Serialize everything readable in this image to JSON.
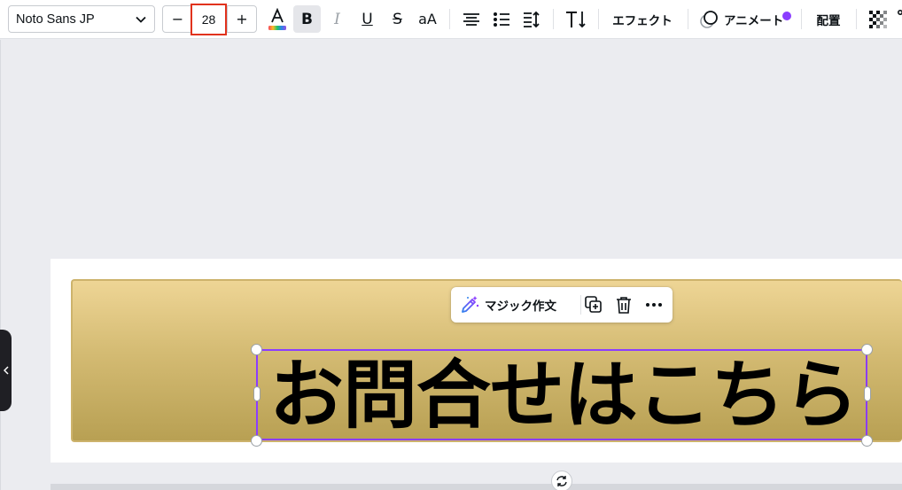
{
  "toolbar": {
    "font_name": "Noto Sans JP",
    "font_size": "28",
    "minus_label": "−",
    "plus_label": "+",
    "bold_label": "B",
    "italic_label": "I",
    "underline_label": "U",
    "strike_label": "S",
    "case_label": "aA",
    "effects_label": "エフェクト",
    "animate_label": "アニメート",
    "position_label": "配置"
  },
  "floating_toolbar": {
    "magic_write_label": "マジック作文"
  },
  "canvas": {
    "headline_text": "お問合せはこちら"
  },
  "colors": {
    "selection": "#8b3dff",
    "highlight_box": "#e1321d",
    "banner_top": "#eed595",
    "banner_bottom": "#b8a053"
  }
}
